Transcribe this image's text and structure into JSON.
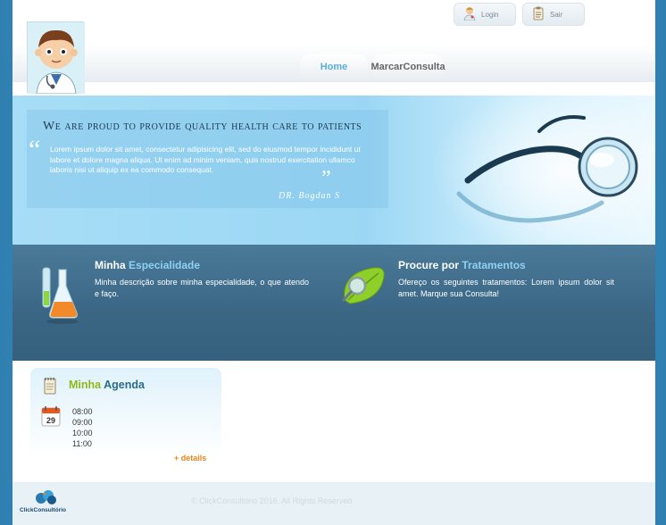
{
  "header": {
    "login_label": "Login",
    "logout_label": "Sair",
    "nav": [
      {
        "label": "Home",
        "color": "#5aaed8"
      },
      {
        "label": "MarcarConsulta",
        "color": "#666666"
      }
    ]
  },
  "hero": {
    "title": "We are proud to provide quality health care to patients",
    "text": "Lorem ipsum dolor sit amet, consectetur adipisicing elit, sed do eiusmod tempor incididunt ut labore et dolore magna aliqua. Ut enim ad minim veniam, quis nostrud exercitation ullamco laboris nisi ut aliquip ex ea commodo consequat.",
    "signature": "DR. Bogdan S"
  },
  "features": [
    {
      "title_prefix": "Minha",
      "title_highlight": "Especialidade",
      "text": "Minha descrição sobre minha especialidade, o que atendo e faço.",
      "icon": "flask-icon"
    },
    {
      "title_prefix": "Procure por",
      "title_highlight": "Tratamentos",
      "text": "Ofereço os seguintes tratamentos: Lorem ipsum dolor sit amet. Marque sua Consulta!",
      "icon": "leaf-magnifier-icon"
    }
  ],
  "agenda": {
    "title_prefix": "Minha",
    "title_rest": "Agenda",
    "calendar_day": "29",
    "times": [
      "08:00",
      "09:00",
      "10:00",
      "11:00"
    ],
    "details_label": "+ details"
  },
  "footer": {
    "copyright": "© ClickConsultório 2016. All Rights Reserved",
    "brand": "ClickConsultório"
  },
  "colors": {
    "accent_blue": "#8fd0f2",
    "agenda_green": "#8fb81a",
    "details_orange": "#e8861a"
  }
}
